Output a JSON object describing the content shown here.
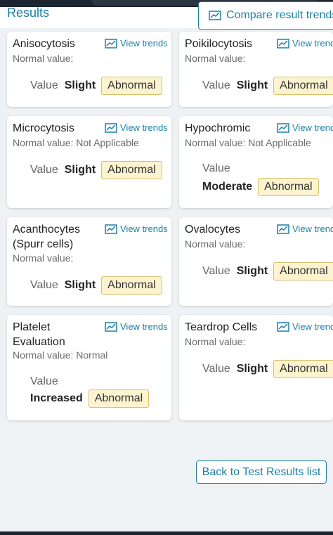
{
  "header": {
    "title": "Results",
    "compare_label": "Compare result trends"
  },
  "cards": [
    {
      "title": "Anisocytosis",
      "trend_label": "View trends",
      "normal": "Normal value:",
      "value_label": "Value",
      "value": "Slight",
      "status": "Abnormal"
    },
    {
      "title": "Poikilocytosis",
      "trend_label": "View trends",
      "normal": "Normal value:",
      "value_label": "Value",
      "value": "Slight",
      "status": "Abnormal"
    },
    {
      "title": "Microcytosis",
      "trend_label": "View trends",
      "normal": "Normal value: Not Applicable",
      "value_label": "Value",
      "value": "Slight",
      "status": "Abnormal"
    },
    {
      "title": "Hypochromic",
      "trend_label": "View trends",
      "normal": "Normal value: Not Applicable",
      "value_label": "Value",
      "value": "Moderate",
      "status": "Abnormal"
    },
    {
      "title": "Acanthocytes (Spurr cells)",
      "trend_label": "View trends",
      "normal": "Normal value:",
      "value_label": "Value",
      "value": "Slight",
      "status": "Abnormal"
    },
    {
      "title": "Ovalocytes",
      "trend_label": "View trends",
      "normal": "Normal value:",
      "value_label": "Value",
      "value": "Slight",
      "status": "Abnormal"
    },
    {
      "title": "Platelet Evaluation",
      "trend_label": "View trends",
      "normal": "Normal value: Normal",
      "value_label": "Value",
      "value": "Increased",
      "status": "Abnormal"
    },
    {
      "title": "Teardrop Cells",
      "trend_label": "View trends",
      "normal": "Normal value:",
      "value_label": "Value",
      "value": "Slight",
      "status": "Abnormal"
    }
  ],
  "footer": {
    "back_label": "Back to Test Results list"
  },
  "colors": {
    "accent": "#1a7fa8",
    "badge_bg": "#fdf3cf",
    "badge_border": "#d8bf6e"
  }
}
